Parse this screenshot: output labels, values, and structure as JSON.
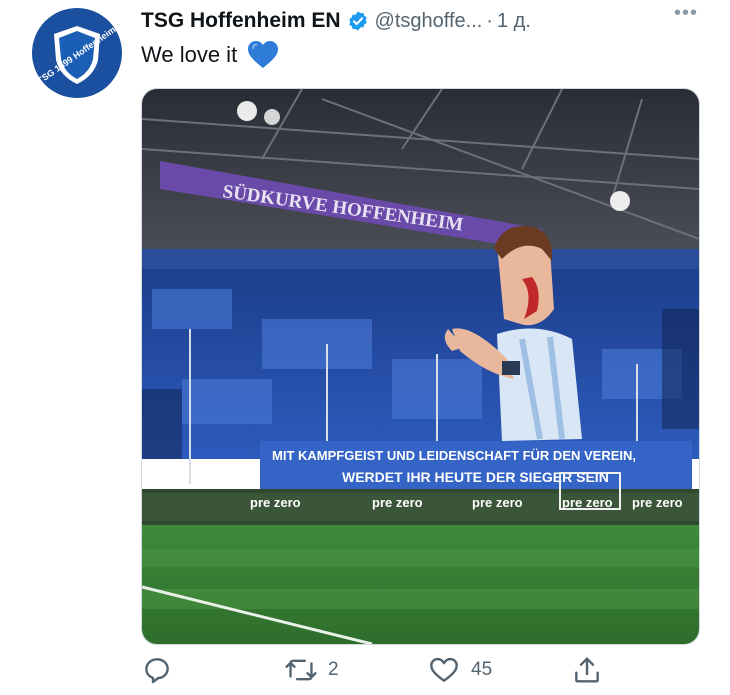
{
  "tweet": {
    "author_name": "TSG Hoffenheim EN",
    "handle": "@tsghoffe...",
    "separator": "·",
    "time": "1 д.",
    "text": "We love it",
    "emoji": "blue-heart",
    "verified": true,
    "accent_color": "#1d9bf0",
    "avatar_text": "TSG 1899 Hoffenheim"
  },
  "media": {
    "banner_text": "SÜDKURVE HOFFENHEIM",
    "fan_banner_line1": "MIT KAMPFGEIST UND LEIDENSCHAFT FÜR DEN VEREIN,",
    "fan_banner_line2": "WERDET IHR HEUTE DER SIEGER SEIN",
    "ad_boards": [
      "pre zero",
      "pre zero",
      "pre zero",
      "pre zero",
      "pre zero"
    ]
  },
  "actions": {
    "reply": {
      "icon": "reply-icon",
      "count": ""
    },
    "retweet": {
      "icon": "retweet-icon",
      "count": "2"
    },
    "like": {
      "icon": "like-icon",
      "count": "45"
    },
    "share": {
      "icon": "share-icon",
      "count": ""
    }
  }
}
